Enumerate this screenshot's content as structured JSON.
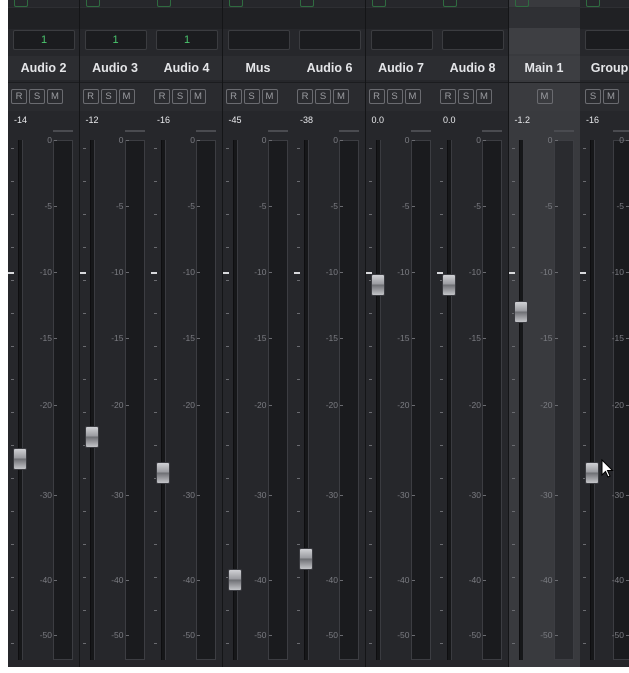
{
  "channels": [
    {
      "name": "Audio 2",
      "route": "1",
      "buttons": [
        "R",
        "S",
        "M"
      ],
      "volume": "-14",
      "fader_db": -26
    },
    {
      "name": "Audio 3",
      "route": "1",
      "buttons": [
        "R",
        "S",
        "M"
      ],
      "volume": "-12",
      "fader_db": -23.5
    },
    {
      "name": "Audio 4",
      "route": "1",
      "buttons": [
        "R",
        "S",
        "M"
      ],
      "volume": "-16",
      "fader_db": -27.5
    },
    {
      "name": "Mus",
      "route": "",
      "buttons": [
        "R",
        "S",
        "M"
      ],
      "volume": "-45",
      "fader_db": -40
    },
    {
      "name": "Audio 6",
      "route": "",
      "buttons": [
        "R",
        "S",
        "M"
      ],
      "volume": "-38",
      "fader_db": -37.5
    },
    {
      "name": "Audio 7",
      "route": "",
      "buttons": [
        "R",
        "S",
        "M"
      ],
      "volume": "0.0",
      "fader_db": -11
    },
    {
      "name": "Audio 8",
      "route": "",
      "buttons": [
        "R",
        "S",
        "M"
      ],
      "volume": "0.0",
      "fader_db": -11
    },
    {
      "name": "Main 1",
      "route": "",
      "buttons": [
        "M"
      ],
      "volume": "-1.2",
      "fader_db": -13,
      "is_main": true
    },
    {
      "name": "Group",
      "route": "",
      "buttons": [
        "S",
        "M"
      ],
      "volume": "-16",
      "fader_db": -27.5
    }
  ],
  "scale_labels": [
    "0",
    "-5",
    "-10",
    "-15",
    "-20",
    "-30",
    "-40",
    "-50"
  ],
  "colors": {
    "route_text": "#49c46c",
    "background": "#1e1f22"
  }
}
